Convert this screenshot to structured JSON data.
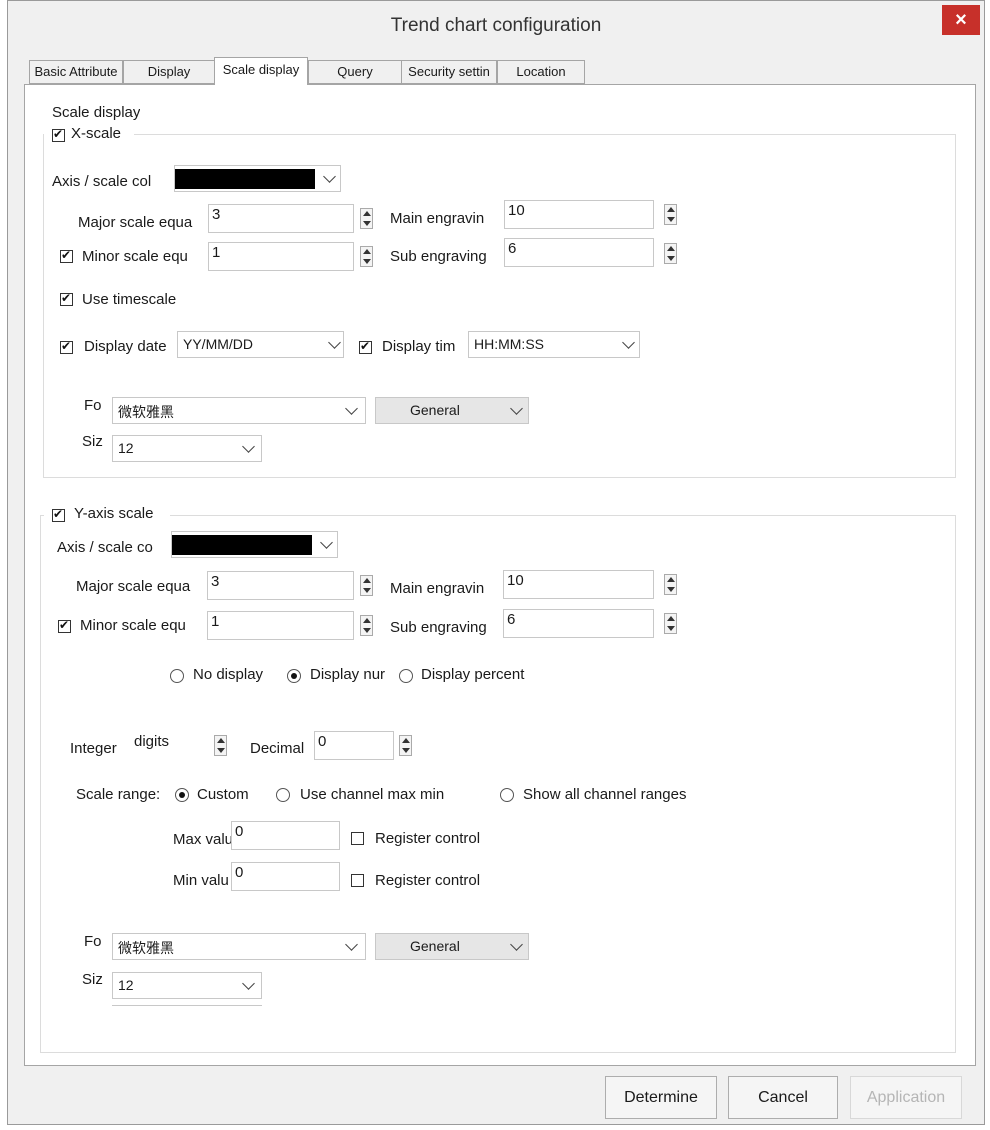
{
  "window": {
    "title": "Trend chart configuration"
  },
  "tabs": [
    "Basic Attribute",
    "Display",
    "Scale display",
    "Query",
    "Security settin",
    "Location"
  ],
  "section_title": "Scale display",
  "x_scale": {
    "label": "X-scale",
    "axis_color_label": "Axis / scale col",
    "major_label": "Major scale equa",
    "major_value": "3",
    "main_engraving_label": "Main engravin",
    "main_engraving_value": "10",
    "minor_label": "Minor scale equ",
    "minor_value": "1",
    "sub_engraving_label": "Sub engraving",
    "sub_engraving_value": "6",
    "use_timescale_label": "Use timescale",
    "display_date_label": "Display date",
    "date_format": "YY/MM/DD",
    "display_time_label": "Display tim",
    "time_format": "HH:MM:SS",
    "font_label": "Fo",
    "font_value": "微软雅黑",
    "font_style": "General",
    "size_label": "Siz",
    "size_value": "12"
  },
  "y_scale": {
    "label": "Y-axis scale",
    "axis_color_label": "Axis / scale co",
    "major_label": "Major scale equa",
    "major_value": "3",
    "main_engraving_label": "Main engravin",
    "main_engraving_value": "10",
    "minor_label": "Minor scale equ",
    "minor_value": "1",
    "sub_engraving_label": "Sub engraving",
    "sub_engraving_value": "6",
    "radio_no_display": "No display",
    "radio_display_num": "Display nur",
    "radio_display_percent": "Display percent",
    "integer_label": "Integer",
    "integer_value": "digits",
    "decimal_label": "Decimal",
    "decimal_value": "0",
    "scale_range_label": "Scale range:",
    "range_custom": "Custom",
    "range_channel_max_min": "Use channel max min",
    "range_show_all": "Show all channel ranges",
    "max_label": "Max value",
    "max_value": "0",
    "min_label": "Min valu",
    "min_value": "0",
    "register_control_1": "Register control",
    "register_control_2": "Register control",
    "font_label": "Fo",
    "font_value": "微软雅黑",
    "font_style": "General",
    "size_label": "Siz",
    "size_value": "12"
  },
  "buttons": {
    "determine": "Determine",
    "cancel": "Cancel",
    "application": "Application"
  },
  "colors": {
    "close_button": "#c7302a",
    "axis_color": "#000000"
  }
}
